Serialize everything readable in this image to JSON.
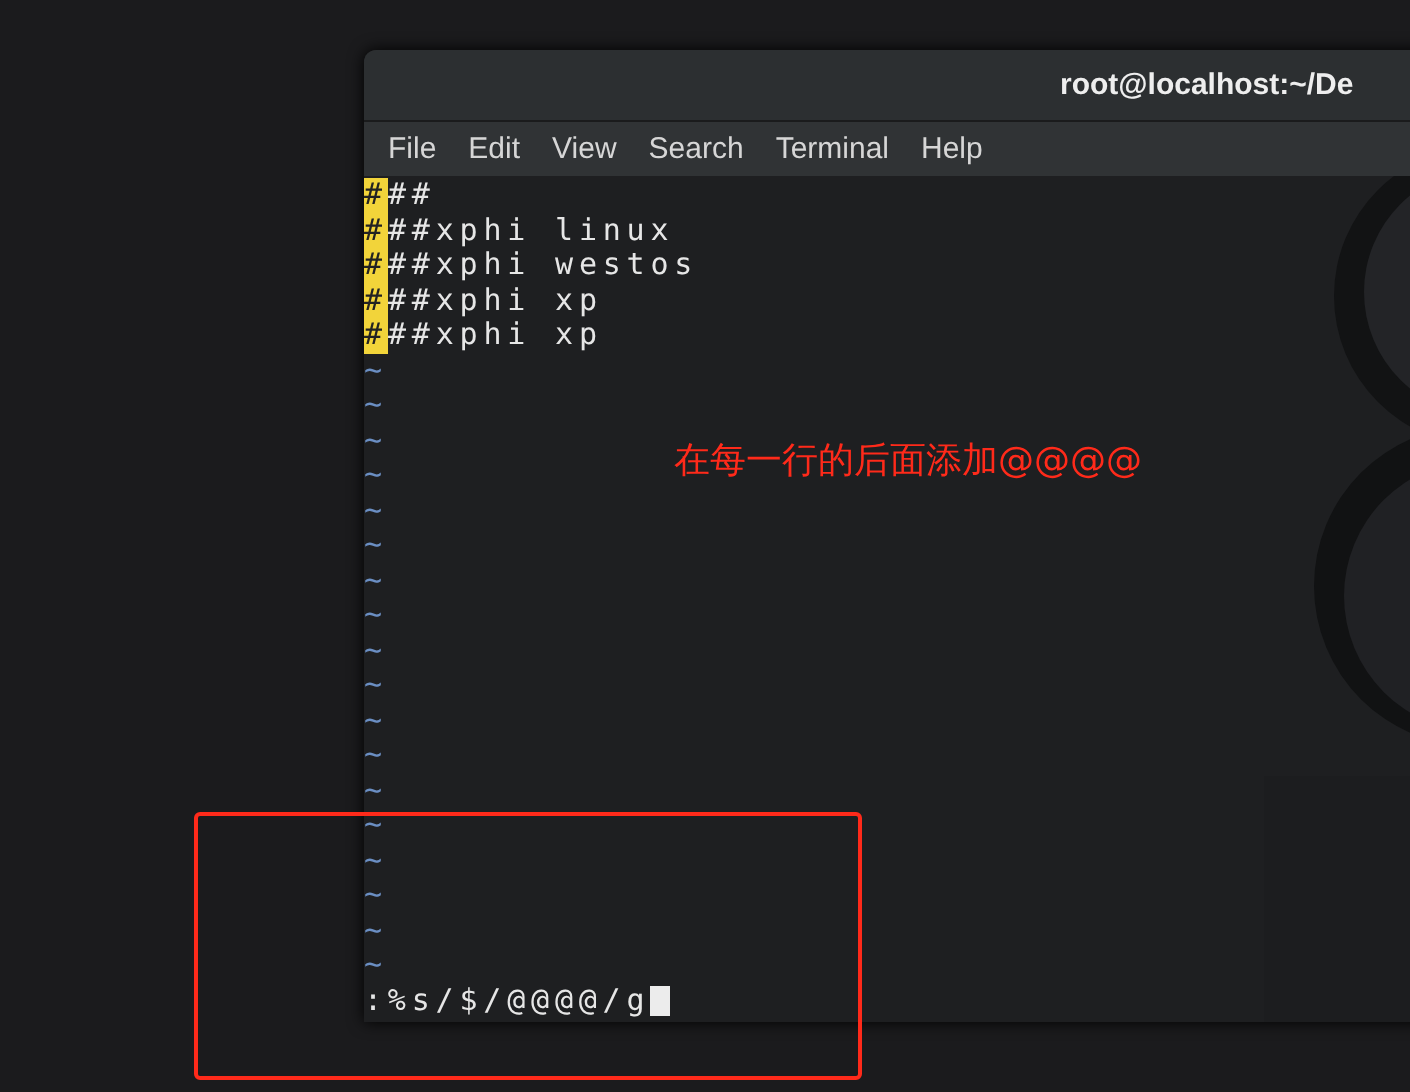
{
  "window": {
    "title": "root@localhost:~/De"
  },
  "menu": [
    {
      "label": "File"
    },
    {
      "label": "Edit"
    },
    {
      "label": "View"
    },
    {
      "label": "Search"
    },
    {
      "label": "Terminal"
    },
    {
      "label": "Help"
    }
  ],
  "buffer": {
    "lines": [
      {
        "highlighted": "#",
        "text": "##"
      },
      {
        "highlighted": "#",
        "text": "##xphi linux"
      },
      {
        "highlighted": "#",
        "text": "##xphi westos"
      },
      {
        "highlighted": "#",
        "text": "##xphi xp"
      },
      {
        "highlighted": "#",
        "text": "##xphi xp"
      }
    ],
    "filler_lines": [
      "~",
      "~",
      "~",
      "~",
      "~",
      "~",
      "~",
      "~",
      "~",
      "~",
      "~",
      "~",
      "~",
      "~",
      "~",
      "~",
      "~",
      "~"
    ]
  },
  "command_line": {
    "text": ":%s/$/@@@@/g",
    "cursor": true
  },
  "annotation": {
    "text": "在每一行的后面添加@@@@",
    "frame": true
  }
}
